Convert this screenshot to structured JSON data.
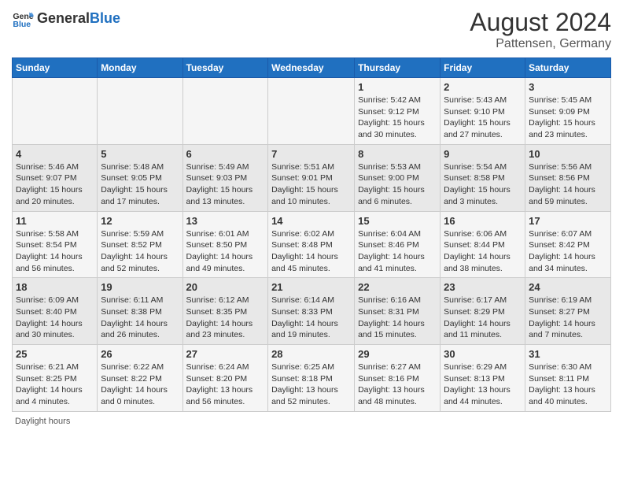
{
  "header": {
    "logo_general": "General",
    "logo_blue": "Blue",
    "title": "August 2024",
    "subtitle": "Pattensen, Germany"
  },
  "days_of_week": [
    "Sunday",
    "Monday",
    "Tuesday",
    "Wednesday",
    "Thursday",
    "Friday",
    "Saturday"
  ],
  "weeks": [
    [
      {
        "day": "",
        "info": ""
      },
      {
        "day": "",
        "info": ""
      },
      {
        "day": "",
        "info": ""
      },
      {
        "day": "",
        "info": ""
      },
      {
        "day": "1",
        "info": "Sunrise: 5:42 AM\nSunset: 9:12 PM\nDaylight: 15 hours\nand 30 minutes."
      },
      {
        "day": "2",
        "info": "Sunrise: 5:43 AM\nSunset: 9:10 PM\nDaylight: 15 hours\nand 27 minutes."
      },
      {
        "day": "3",
        "info": "Sunrise: 5:45 AM\nSunset: 9:09 PM\nDaylight: 15 hours\nand 23 minutes."
      }
    ],
    [
      {
        "day": "4",
        "info": "Sunrise: 5:46 AM\nSunset: 9:07 PM\nDaylight: 15 hours\nand 20 minutes."
      },
      {
        "day": "5",
        "info": "Sunrise: 5:48 AM\nSunset: 9:05 PM\nDaylight: 15 hours\nand 17 minutes."
      },
      {
        "day": "6",
        "info": "Sunrise: 5:49 AM\nSunset: 9:03 PM\nDaylight: 15 hours\nand 13 minutes."
      },
      {
        "day": "7",
        "info": "Sunrise: 5:51 AM\nSunset: 9:01 PM\nDaylight: 15 hours\nand 10 minutes."
      },
      {
        "day": "8",
        "info": "Sunrise: 5:53 AM\nSunset: 9:00 PM\nDaylight: 15 hours\nand 6 minutes."
      },
      {
        "day": "9",
        "info": "Sunrise: 5:54 AM\nSunset: 8:58 PM\nDaylight: 15 hours\nand 3 minutes."
      },
      {
        "day": "10",
        "info": "Sunrise: 5:56 AM\nSunset: 8:56 PM\nDaylight: 14 hours\nand 59 minutes."
      }
    ],
    [
      {
        "day": "11",
        "info": "Sunrise: 5:58 AM\nSunset: 8:54 PM\nDaylight: 14 hours\nand 56 minutes."
      },
      {
        "day": "12",
        "info": "Sunrise: 5:59 AM\nSunset: 8:52 PM\nDaylight: 14 hours\nand 52 minutes."
      },
      {
        "day": "13",
        "info": "Sunrise: 6:01 AM\nSunset: 8:50 PM\nDaylight: 14 hours\nand 49 minutes."
      },
      {
        "day": "14",
        "info": "Sunrise: 6:02 AM\nSunset: 8:48 PM\nDaylight: 14 hours\nand 45 minutes."
      },
      {
        "day": "15",
        "info": "Sunrise: 6:04 AM\nSunset: 8:46 PM\nDaylight: 14 hours\nand 41 minutes."
      },
      {
        "day": "16",
        "info": "Sunrise: 6:06 AM\nSunset: 8:44 PM\nDaylight: 14 hours\nand 38 minutes."
      },
      {
        "day": "17",
        "info": "Sunrise: 6:07 AM\nSunset: 8:42 PM\nDaylight: 14 hours\nand 34 minutes."
      }
    ],
    [
      {
        "day": "18",
        "info": "Sunrise: 6:09 AM\nSunset: 8:40 PM\nDaylight: 14 hours\nand 30 minutes."
      },
      {
        "day": "19",
        "info": "Sunrise: 6:11 AM\nSunset: 8:38 PM\nDaylight: 14 hours\nand 26 minutes."
      },
      {
        "day": "20",
        "info": "Sunrise: 6:12 AM\nSunset: 8:35 PM\nDaylight: 14 hours\nand 23 minutes."
      },
      {
        "day": "21",
        "info": "Sunrise: 6:14 AM\nSunset: 8:33 PM\nDaylight: 14 hours\nand 19 minutes."
      },
      {
        "day": "22",
        "info": "Sunrise: 6:16 AM\nSunset: 8:31 PM\nDaylight: 14 hours\nand 15 minutes."
      },
      {
        "day": "23",
        "info": "Sunrise: 6:17 AM\nSunset: 8:29 PM\nDaylight: 14 hours\nand 11 minutes."
      },
      {
        "day": "24",
        "info": "Sunrise: 6:19 AM\nSunset: 8:27 PM\nDaylight: 14 hours\nand 7 minutes."
      }
    ],
    [
      {
        "day": "25",
        "info": "Sunrise: 6:21 AM\nSunset: 8:25 PM\nDaylight: 14 hours\nand 4 minutes."
      },
      {
        "day": "26",
        "info": "Sunrise: 6:22 AM\nSunset: 8:22 PM\nDaylight: 14 hours\nand 0 minutes."
      },
      {
        "day": "27",
        "info": "Sunrise: 6:24 AM\nSunset: 8:20 PM\nDaylight: 13 hours\nand 56 minutes."
      },
      {
        "day": "28",
        "info": "Sunrise: 6:25 AM\nSunset: 8:18 PM\nDaylight: 13 hours\nand 52 minutes."
      },
      {
        "day": "29",
        "info": "Sunrise: 6:27 AM\nSunset: 8:16 PM\nDaylight: 13 hours\nand 48 minutes."
      },
      {
        "day": "30",
        "info": "Sunrise: 6:29 AM\nSunset: 8:13 PM\nDaylight: 13 hours\nand 44 minutes."
      },
      {
        "day": "31",
        "info": "Sunrise: 6:30 AM\nSunset: 8:11 PM\nDaylight: 13 hours\nand 40 minutes."
      }
    ]
  ],
  "footer": {
    "daylight_hours_label": "Daylight hours"
  }
}
